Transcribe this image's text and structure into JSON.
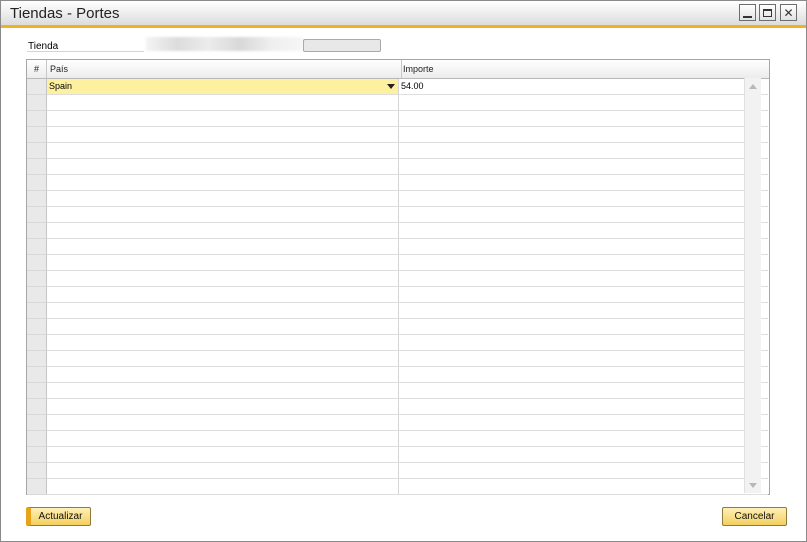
{
  "window": {
    "title": "Tiendas - Portes",
    "controls": {
      "minimize": "minimize-icon",
      "maximize": "maximize-icon",
      "close": "close-icon"
    }
  },
  "form": {
    "tienda_label": "Tienda"
  },
  "grid": {
    "columns": [
      "#",
      "País",
      "Importe"
    ],
    "rows": [
      {
        "pais": "Spain",
        "importe": "54.00"
      },
      {
        "pais": "",
        "importe": ""
      },
      {
        "pais": "",
        "importe": ""
      },
      {
        "pais": "",
        "importe": ""
      },
      {
        "pais": "",
        "importe": ""
      },
      {
        "pais": "",
        "importe": ""
      },
      {
        "pais": "",
        "importe": ""
      },
      {
        "pais": "",
        "importe": ""
      },
      {
        "pais": "",
        "importe": ""
      },
      {
        "pais": "",
        "importe": ""
      },
      {
        "pais": "",
        "importe": ""
      },
      {
        "pais": "",
        "importe": ""
      },
      {
        "pais": "",
        "importe": ""
      },
      {
        "pais": "",
        "importe": ""
      },
      {
        "pais": "",
        "importe": ""
      },
      {
        "pais": "",
        "importe": ""
      },
      {
        "pais": "",
        "importe": ""
      },
      {
        "pais": "",
        "importe": ""
      },
      {
        "pais": "",
        "importe": ""
      },
      {
        "pais": "",
        "importe": ""
      },
      {
        "pais": "",
        "importe": ""
      },
      {
        "pais": "",
        "importe": ""
      },
      {
        "pais": "",
        "importe": ""
      },
      {
        "pais": "",
        "importe": ""
      },
      {
        "pais": "",
        "importe": ""
      },
      {
        "pais": "",
        "importe": ""
      }
    ]
  },
  "buttons": {
    "actualizar": "Actualizar",
    "cancelar": "Cancelar"
  },
  "colors": {
    "accent": "#f0b21e",
    "active_cell": "#fdf1a0",
    "button": "#f4cf5f"
  }
}
